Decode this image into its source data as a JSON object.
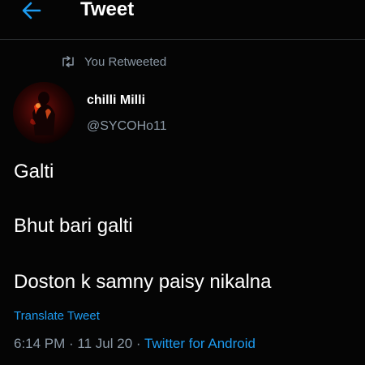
{
  "header": {
    "back_icon": "arrow-left-icon",
    "title": "Tweet",
    "accent_color": "#1d9bf0"
  },
  "retweet_context": {
    "icon": "retweet-icon",
    "text": "You Retweeted"
  },
  "author": {
    "display_name": "chilli Milli",
    "handle": "@SYCOHo11"
  },
  "tweet": {
    "lines": [
      "Galti",
      "Bhut bari galti",
      "Doston k samny paisy nikalna"
    ],
    "translate_label": "Translate Tweet"
  },
  "meta": {
    "time": "6:14 PM",
    "sep1": " · ",
    "date": "11 Jul 20",
    "sep2": " · ",
    "source": "Twitter for Android"
  }
}
